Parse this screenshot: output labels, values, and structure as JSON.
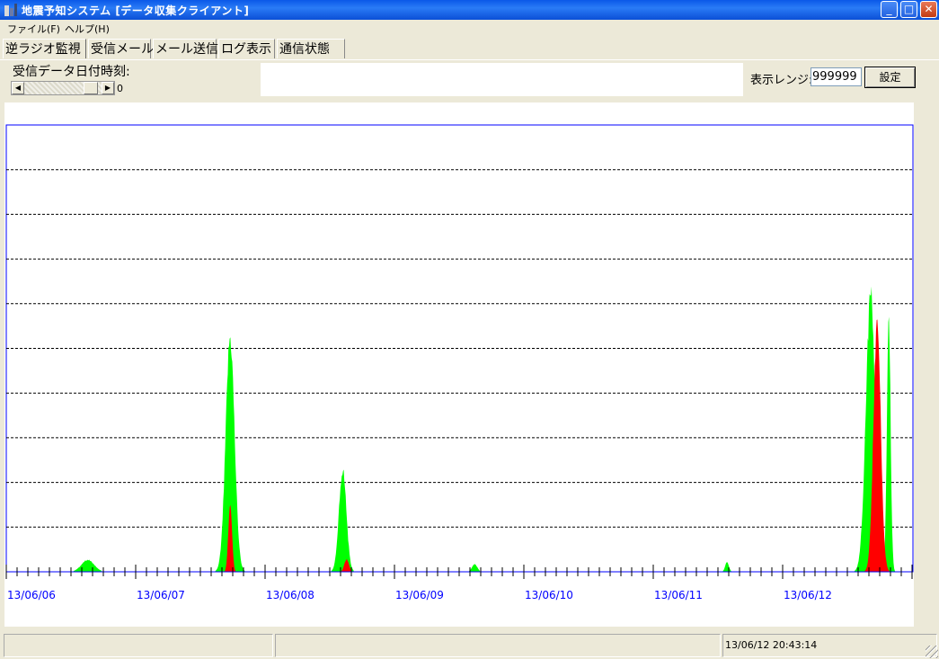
{
  "window": {
    "title": "地震予知システム [データ収集クライアント]"
  },
  "menu": [
    {
      "label": "ファイル(F)"
    },
    {
      "label": "ヘルプ(H)"
    }
  ],
  "tabs": [
    {
      "label": "逆ラジオ監視"
    },
    {
      "label": "受信メール"
    },
    {
      "label": "メール送信"
    },
    {
      "label": "ログ表示"
    },
    {
      "label": "通信状態"
    }
  ],
  "controls": {
    "date_label": "受信データ日付時刻:",
    "scroll_value": "0",
    "range_label": "表示レンジ:",
    "range_value": "999999",
    "set_button": "設定"
  },
  "chart_data": {
    "type": "area",
    "x_labels": [
      "13/06/06",
      "13/06/07",
      "13/06/08",
      "13/06/09",
      "13/06/10",
      "13/06/11",
      "13/06/12"
    ],
    "y_gridlines": 9,
    "grid": true,
    "colors": {
      "green": "#00ff00",
      "red": "#ff0000",
      "axis": "#0000ff",
      "label": "#0000ff"
    },
    "series": [
      {
        "color": "green",
        "peaks": [
          {
            "day": 0.63,
            "height": 0.028,
            "width": 0.17
          },
          {
            "day": 1.73,
            "height": 0.55,
            "width": 0.12
          },
          {
            "day": 2.6,
            "height": 0.24,
            "width": 0.1
          },
          {
            "day": 3.62,
            "height": 0.018,
            "width": 0.07
          },
          {
            "day": 5.57,
            "height": 0.022,
            "width": 0.05
          },
          {
            "day": 6.68,
            "height": 0.65,
            "width": 0.13
          },
          {
            "day": 6.82,
            "height": 0.6,
            "width": 0.05
          }
        ]
      },
      {
        "color": "red",
        "peaks": [
          {
            "day": 1.73,
            "height": 0.16,
            "width": 0.05
          },
          {
            "day": 2.63,
            "height": 0.03,
            "width": 0.06
          },
          {
            "day": 6.73,
            "height": 0.58,
            "width": 0.1
          }
        ]
      }
    ]
  },
  "status": {
    "pane1": "",
    "pane2": "",
    "pane3": "13/06/12 20:43:14"
  }
}
